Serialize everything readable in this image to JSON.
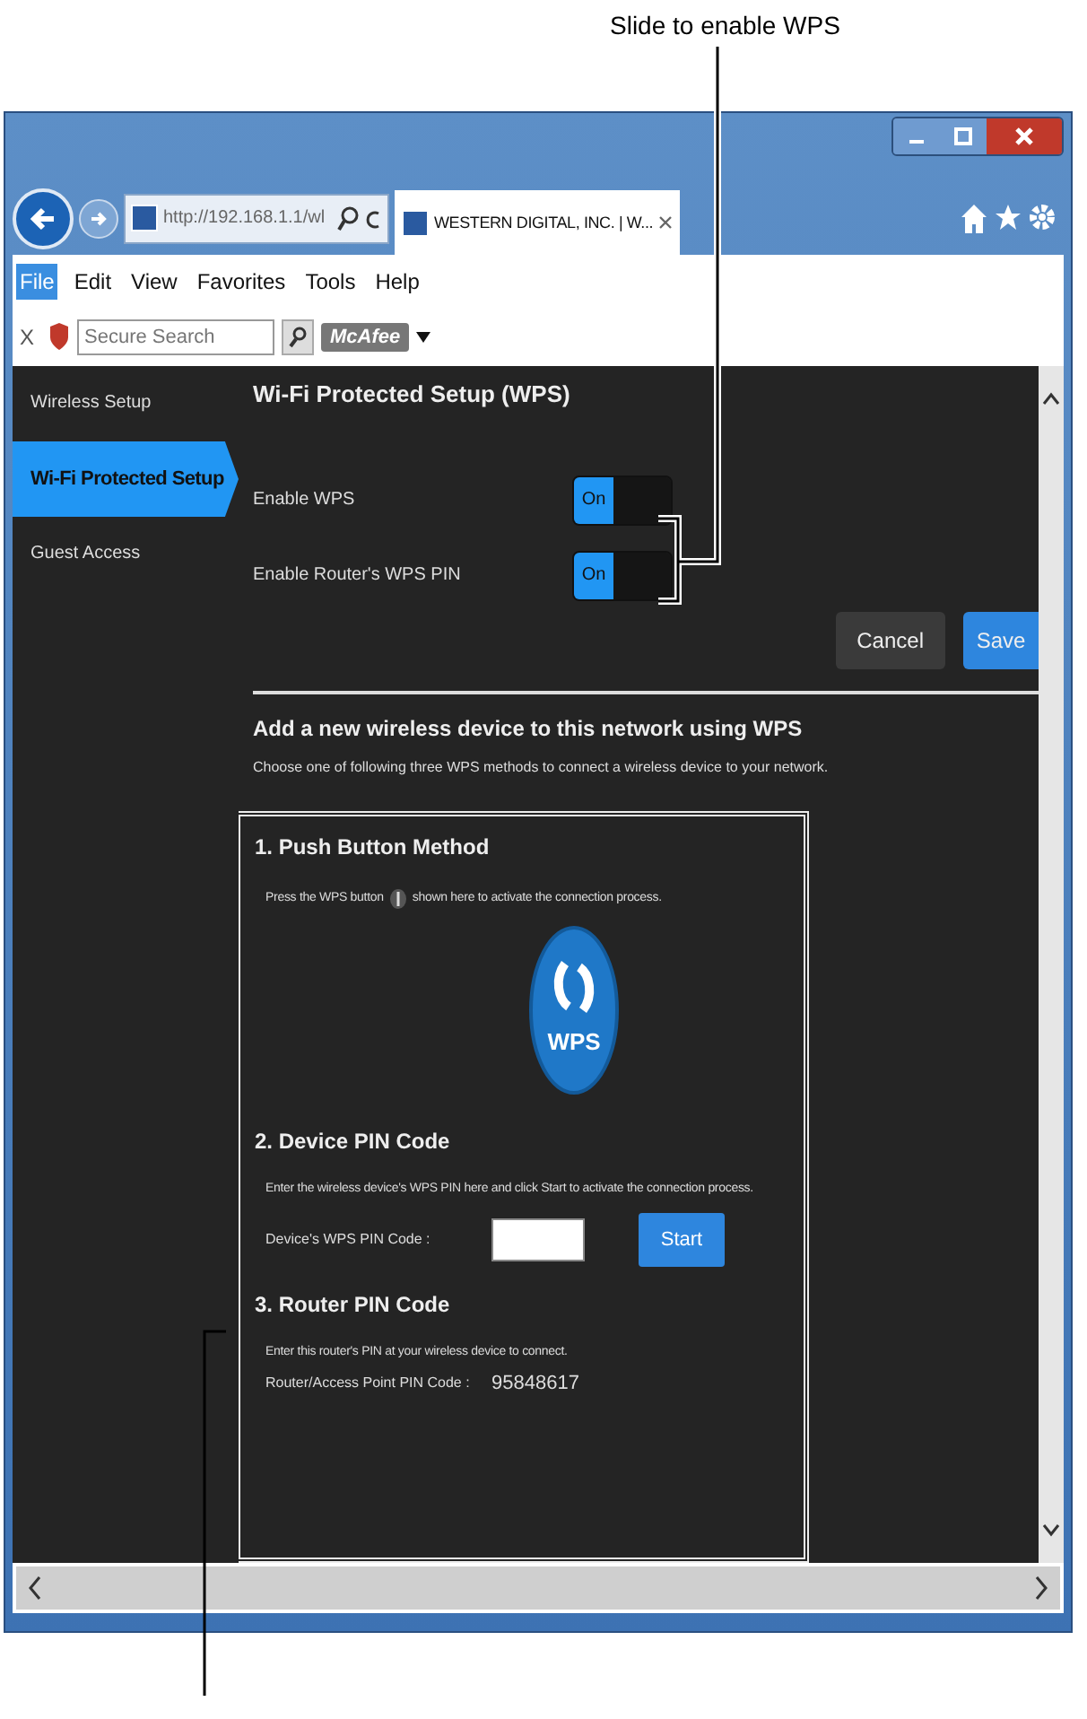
{
  "callout": {
    "top_label": "Slide to enable WPS"
  },
  "browser": {
    "address": "http://192.168.1.1/wl",
    "tab_title": "WESTERN DIGITAL, INC. | W...",
    "menu": [
      {
        "label": "File",
        "selected": true
      },
      {
        "label": "Edit",
        "selected": false
      },
      {
        "label": "View",
        "selected": false
      },
      {
        "label": "Favorites",
        "selected": false
      },
      {
        "label": "Tools",
        "selected": false
      },
      {
        "label": "Help",
        "selected": false
      }
    ],
    "toolbar": {
      "close": "X",
      "search_placeholder": "Secure Search",
      "badge": "McAfee"
    }
  },
  "sidebar": {
    "items": [
      {
        "label": "Wireless Setup",
        "selected": false
      },
      {
        "label": "Wi-Fi Protected Setup",
        "selected": true
      },
      {
        "label": "Guest Access",
        "selected": false
      }
    ]
  },
  "page": {
    "title": "Wi-Fi Protected Setup (WPS)",
    "toggles": [
      {
        "label": "Enable WPS",
        "state": "On",
        "on": true
      },
      {
        "label": "Enable Router's WPS PIN",
        "state": "On",
        "on": true
      }
    ],
    "buttons": [
      {
        "label": "Cancel",
        "kind": "secondary"
      },
      {
        "label": "Save",
        "kind": "primary"
      }
    ],
    "section_title": "Add a new wireless device to this network using WPS",
    "section_desc": "Choose one of following three WPS methods to connect a wireless device to your network.",
    "push": {
      "title": "1. Push Button Method",
      "text_before": "Press the WPS button",
      "text_after": "shown here to activate the connection process.",
      "logo": "WPS"
    },
    "device_pin": {
      "title": "2. Device PIN Code",
      "text": "Enter the wireless device's WPS PIN here and click Start to activate the connection process.",
      "label": "Device's WPS PIN Code :",
      "button": "Start"
    },
    "router_pin": {
      "title": "3. Router PIN Code",
      "text": "Enter this router's PIN at your wireless device to connect.",
      "label": "Router/Access Point PIN Code :",
      "value": "95848617"
    }
  }
}
